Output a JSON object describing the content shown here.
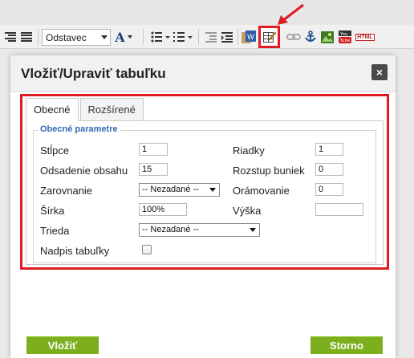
{
  "toolbar": {
    "format_select": "Odstavec",
    "icons": [
      "align-right-icon",
      "justify-icon",
      "font-color-icon",
      "bullet-list-icon",
      "numbered-list-icon",
      "outdent-icon",
      "indent-icon",
      "paste-word-icon",
      "paste-text-icon",
      "table-edit-icon",
      "link-icon",
      "anchor-icon",
      "image-icon",
      "youtube-icon",
      "html-icon"
    ],
    "font_color_glyph": "A",
    "youtube_label": "You Tube",
    "html_label": "HTML"
  },
  "dialog": {
    "title": "Vložiť/Upraviť tabuľku",
    "close_glyph": "×",
    "tabs": [
      {
        "label": "Obecné"
      },
      {
        "label": "Rozšírené"
      }
    ],
    "legend": "Obecné parametre",
    "fields": {
      "columns_label": "Stĺpce",
      "columns_value": "1",
      "rows_label": "Riadky",
      "rows_value": "1",
      "padding_label": "Odsadenie obsahu",
      "padding_value": "15",
      "spacing_label": "Rozstup buniek",
      "spacing_value": "0",
      "align_label": "Zarovnanie",
      "align_value": "-- Nezadané --",
      "border_label": "Orámovanie",
      "border_value": "0",
      "width_label": "Šírka",
      "width_value": "100%",
      "height_label": "Výška",
      "height_value": "",
      "class_label": "Trieda",
      "class_value": "-- Nezadané --",
      "caption_label": "Nadpis tabuľky"
    },
    "buttons": {
      "insert": "Vložiť",
      "cancel": "Storno"
    }
  },
  "colors": {
    "highlight": "#e01b24",
    "legend": "#2e6bb5",
    "button_green": "#7cae1d"
  }
}
